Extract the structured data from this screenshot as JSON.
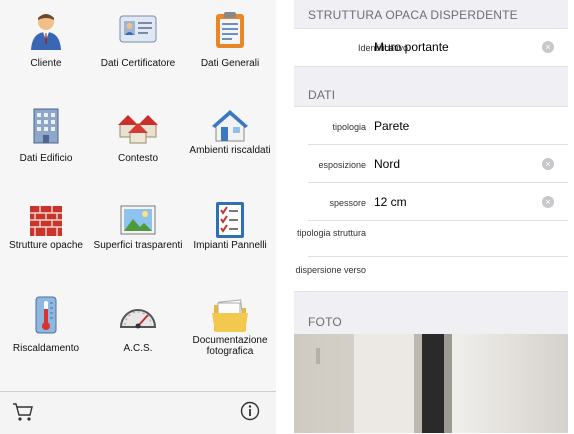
{
  "home": {
    "tiles": [
      {
        "label": "Cliente"
      },
      {
        "label": "Dati Certificatore"
      },
      {
        "label": "Dati Generali"
      },
      {
        "label": "Dati Edificio"
      },
      {
        "label": "Contesto"
      },
      {
        "label": "Ambienti riscaldati"
      },
      {
        "label": "Strutture opache"
      },
      {
        "label": "Superfici trasparenti"
      },
      {
        "label": "Impianti Pannelli"
      },
      {
        "label": "Riscaldamento"
      },
      {
        "label": "A.C.S."
      },
      {
        "label": "Documentazione fotografica"
      }
    ],
    "toolbar": {
      "cart_icon": "cart-icon",
      "info_icon": "info-icon"
    }
  },
  "detail": {
    "section_title": "STRUTTURA OPACA DISPERDENTE",
    "identificativo": {
      "label": "Identificativo",
      "value": "Muro portante"
    },
    "dati_header": "DATI",
    "fields": [
      {
        "label": "tipologia",
        "value": "Parete"
      },
      {
        "label": "esposizione",
        "value": "Nord"
      },
      {
        "label": "spessore",
        "value": "12 cm"
      },
      {
        "label": "tipologia struttura",
        "value": ""
      },
      {
        "label": "dispersione verso",
        "value": ""
      }
    ],
    "foto_header": "FOTO",
    "clear_symbol": "×"
  }
}
